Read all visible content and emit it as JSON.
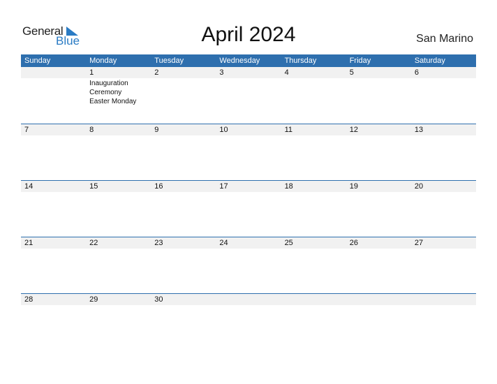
{
  "logo": {
    "general": "General",
    "blue": "Blue"
  },
  "title": "April 2024",
  "country": "San Marino",
  "weekdays": [
    "Sunday",
    "Monday",
    "Tuesday",
    "Wednesday",
    "Thursday",
    "Friday",
    "Saturday"
  ],
  "weeks": [
    {
      "days": [
        "",
        "1",
        "2",
        "3",
        "4",
        "5",
        "6"
      ],
      "events": [
        "",
        "Inauguration\nCeremony\n  Easter Monday",
        "",
        "",
        "",
        "",
        ""
      ]
    },
    {
      "days": [
        "7",
        "8",
        "9",
        "10",
        "11",
        "12",
        "13"
      ],
      "events": [
        "",
        "",
        "",
        "",
        "",
        "",
        ""
      ]
    },
    {
      "days": [
        "14",
        "15",
        "16",
        "17",
        "18",
        "19",
        "20"
      ],
      "events": [
        "",
        "",
        "",
        "",
        "",
        "",
        ""
      ]
    },
    {
      "days": [
        "21",
        "22",
        "23",
        "24",
        "25",
        "26",
        "27"
      ],
      "events": [
        "",
        "",
        "",
        "",
        "",
        "",
        ""
      ]
    },
    {
      "days": [
        "28",
        "29",
        "30",
        "",
        "",
        "",
        ""
      ],
      "events": [
        "",
        "",
        "",
        "",
        "",
        "",
        ""
      ]
    }
  ],
  "colors": {
    "header": "#2e6fae",
    "accent": "#2a7bc4"
  }
}
